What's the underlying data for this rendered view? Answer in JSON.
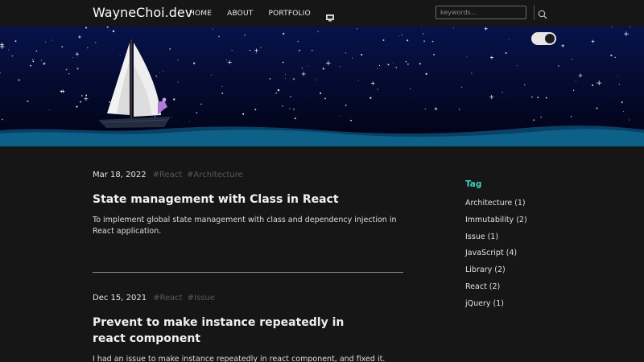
{
  "header": {
    "brand": "WayneChoi.dev",
    "nav": [
      "HOME",
      "ABOUT",
      "PORTFOLIO"
    ],
    "nav_icon": "monitor-icon",
    "search_placeholder": "keywords...",
    "search_icon": "search-icon"
  },
  "hero": {
    "theme_toggle_state": "dark",
    "colors": {
      "sky_top": "#06103f",
      "sky_bottom": "#020418",
      "sea": "#0d6188"
    }
  },
  "posts": [
    {
      "date": "Mar 18, 2022",
      "tags": [
        "#React",
        "#Architecture"
      ],
      "title": "State management with Class in React",
      "description": "To implement global state management with class and dependency injection in React application."
    },
    {
      "date": "Dec 15, 2021",
      "tags": [
        "#React",
        "#Issue"
      ],
      "title": "Prevent to make instance repeatedly in react component",
      "description": "I had an issue to make instance repeatedly in react component, and fixed it."
    }
  ],
  "sidebar": {
    "heading": "Tag",
    "tags": [
      "Architecture (1)",
      "Immutability (2)",
      "Issue (1)",
      "JavaScript (4)",
      "Library (2)",
      "React (2)",
      "jQuery (1)"
    ]
  },
  "colors": {
    "accent": "#3ccfc0",
    "background": "#161616",
    "tag_muted": "#585858"
  }
}
